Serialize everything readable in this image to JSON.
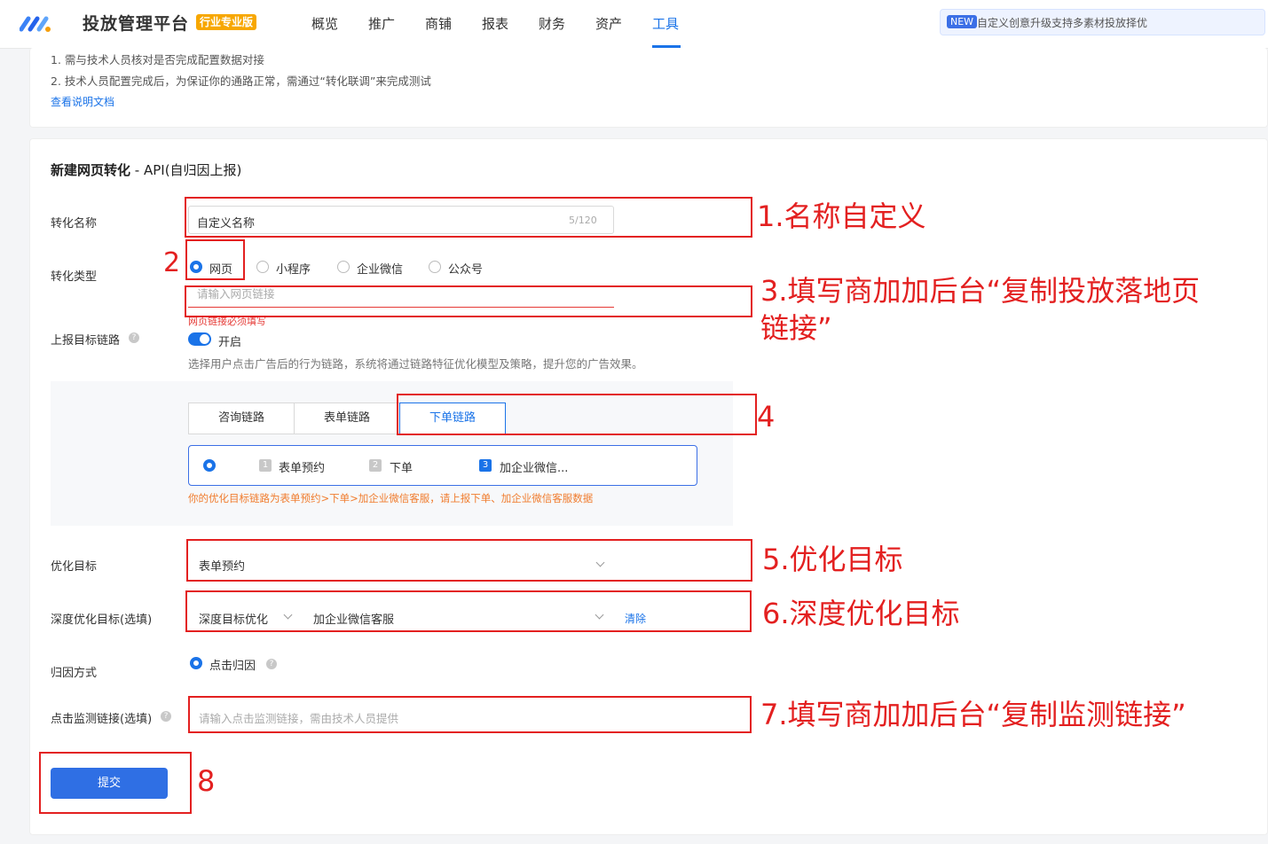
{
  "nav": {
    "brand": "投放管理平台",
    "brand_badge": "行业专业版",
    "items": [
      "概览",
      "推广",
      "商铺",
      "报表",
      "财务",
      "资产",
      "工具"
    ],
    "active": "工具",
    "announce_badge": "NEW",
    "announce_text": "自定义创意升级支持多素材投放择优"
  },
  "tips": {
    "line1": "1. 需与技术人员核对是否完成配置数据对接",
    "line2": "2. 技术人员配置完成后，为保证你的通路正常，需通过“转化联调”来完成测试",
    "doc_link": "查看说明文档"
  },
  "form": {
    "title": "新建网页转化",
    "title_suffix": " - API(自归因上报)",
    "name_label": "转化名称",
    "name_value": "自定义名称",
    "name_count": "5/120",
    "type_label": "转化类型",
    "type_options": [
      "网页",
      "小程序",
      "企业微信",
      "公众号"
    ],
    "url_placeholder": "请输入网页链接",
    "url_error": "网页链接必须填写",
    "chain_label": "上报目标链路",
    "toggle_label": "开启",
    "chain_desc": "选择用户点击广告后的行为链路，系统将通过链路特征优化模型及策略，提升您的广告效果。",
    "tabs": [
      "咨询链路",
      "表单链路",
      "下单链路"
    ],
    "steps": [
      {
        "num": "1",
        "label": "表单预约"
      },
      {
        "num": "2",
        "label": "下单"
      },
      {
        "num": "3",
        "label": "加企业微信..."
      }
    ],
    "chain_hint": "你的优化目标链路为表单预约>下单>加企业微信客服，请上报下单、加企业微信客服数据",
    "opt_label": "优化目标",
    "opt_value": "表单预约",
    "deep_label": "深度优化目标(选填)",
    "deep_type": "深度目标优化",
    "deep_value": "加企业微信客服",
    "deep_clear": "清除",
    "attr_label": "归因方式",
    "attr_value": "点击归因",
    "monitor_label": "点击监测链接(选填)",
    "monitor_placeholder": "请输入点击监测链接，需由技术人员提供",
    "submit": "提交"
  },
  "annotations": {
    "n1": "1.名称自定义",
    "n2": "2",
    "n3a": "3.填写商加加后台“复制投放落地页",
    "n3b": "链接”",
    "n4": "4",
    "n5": "5.优化目标",
    "n6": "6.深度优化目标",
    "n7": "7.填写商加加后台“复制监测链接”",
    "n8": "8"
  },
  "colors": {
    "accent": "#1a73e8",
    "annotation": "#e32020",
    "hint": "#f07c2e"
  }
}
